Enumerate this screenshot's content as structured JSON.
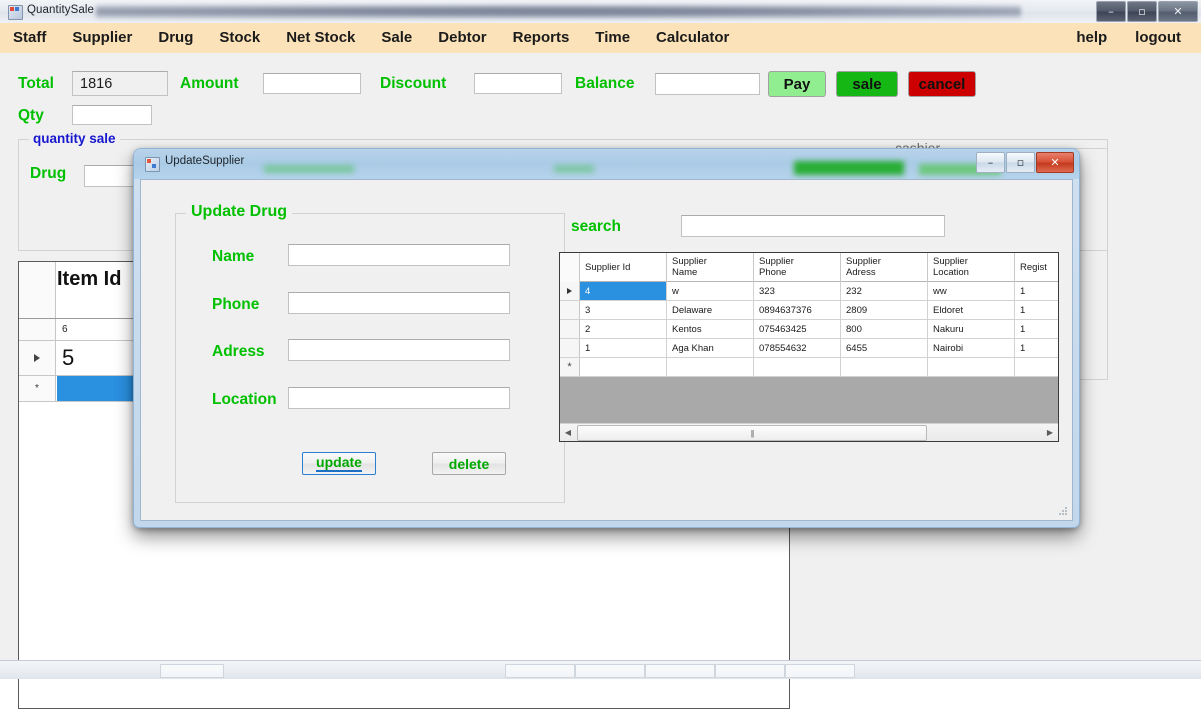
{
  "window": {
    "title": "QuantitySale",
    "app_icon": "app-window-icon",
    "controls": {
      "minimize": "–",
      "maximize": "▫",
      "close": "✕"
    }
  },
  "menubar": {
    "items": [
      "Staff",
      "Supplier",
      "Drug",
      "Stock",
      "Net Stock",
      "Sale",
      "Debtor",
      "Reports",
      "Time",
      "Calculator"
    ],
    "right_items": [
      "help",
      "logout"
    ]
  },
  "sale_form": {
    "total_label": "Total",
    "total_value": "1816",
    "amount_label": "Amount",
    "amount_value": "",
    "discount_label": "Discount",
    "discount_value": "",
    "balance_label": "Balance",
    "balance_value": "",
    "qty_label": "Qty",
    "qty_value": "",
    "buttons": {
      "pay": "Pay",
      "sale": "sale",
      "cancel": "cancel"
    },
    "colors": {
      "pay_bg": "#90ee90",
      "sale_bg": "#15b715",
      "cancel_bg": "#cc0000",
      "label_green": "#00c000",
      "menubar_bg": "#fbe2b8",
      "selection_blue": "#2a90e0"
    },
    "quantity_sale_group": "quantity sale",
    "cashier_group": "cashier",
    "drug_label": "Drug",
    "drug_value": ""
  },
  "background_grid": {
    "header": "Item Id",
    "rows": [
      {
        "marker": "",
        "item_id": "6",
        "selected": false
      },
      {
        "marker": "▶",
        "item_id": "5",
        "selected": false
      },
      {
        "marker": "*",
        "item_id": "",
        "selected": true
      }
    ]
  },
  "dialog": {
    "title": "UpdateSupplier",
    "icon": "form-window-icon",
    "controls": {
      "minimize": "–",
      "maximize": "▫",
      "close": "✕"
    },
    "group_title": "Update Drug",
    "fields": [
      {
        "label": "Name",
        "value": ""
      },
      {
        "label": "Phone",
        "value": ""
      },
      {
        "label": "Adress",
        "value": ""
      },
      {
        "label": "Location",
        "value": ""
      }
    ],
    "buttons": {
      "update": "update",
      "delete": "delete"
    },
    "search_label": "search",
    "search_value": "",
    "grid": {
      "columns": [
        "Supplier Id",
        "Supplier\nName",
        "Supplier\nPhone",
        "Supplier\nAdress",
        "Supplier\nLocation",
        "Regist"
      ],
      "rows": [
        {
          "marker": "▶",
          "selected": true,
          "cells": [
            "4",
            "w",
            "323",
            "232",
            "ww",
            "1"
          ]
        },
        {
          "marker": "",
          "selected": false,
          "cells": [
            "3",
            "Delaware",
            "0894637376",
            "2809",
            "Eldoret",
            "1"
          ]
        },
        {
          "marker": "",
          "selected": false,
          "cells": [
            "2",
            "Kentos",
            "075463425",
            "800",
            "Nakuru",
            "1"
          ]
        },
        {
          "marker": "",
          "selected": false,
          "cells": [
            "1",
            "Aga Khan",
            "078554632",
            "6455",
            "Nairobi",
            "1"
          ]
        },
        {
          "marker": "*",
          "selected": false,
          "cells": [
            "",
            "",
            "",
            "",
            "",
            ""
          ]
        }
      ],
      "scrollbar": {
        "left_arrow": "◀",
        "right_arrow": "▶",
        "thumb_grip": "|||"
      }
    }
  }
}
